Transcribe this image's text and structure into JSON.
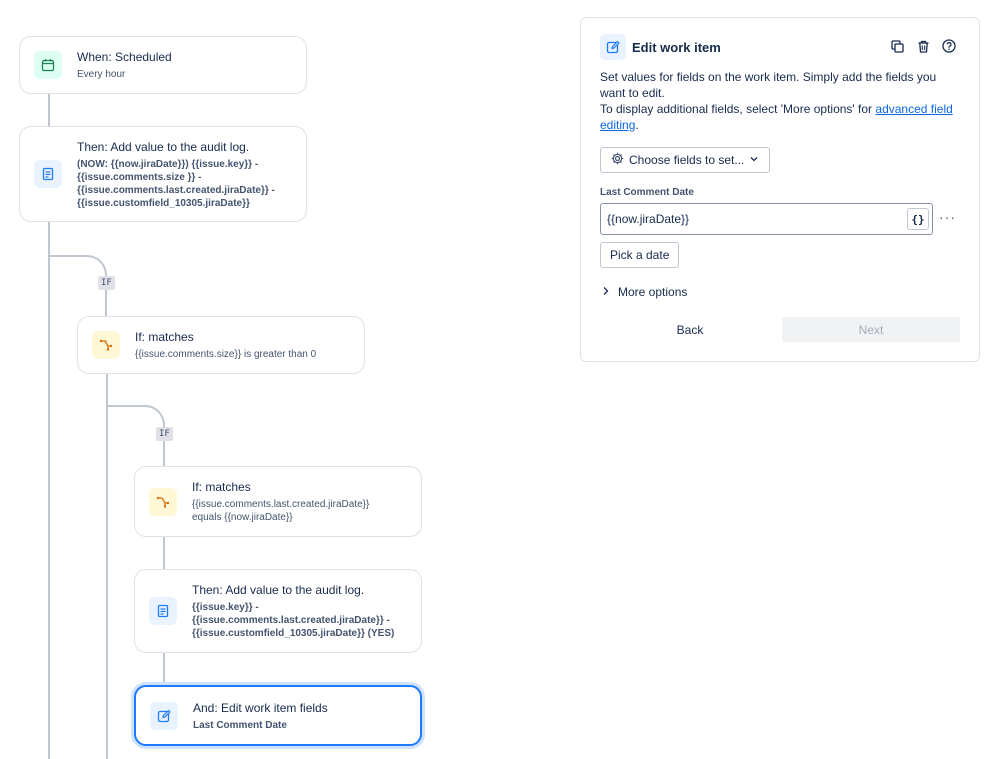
{
  "flow": {
    "trigger": {
      "title": "When: Scheduled",
      "subtitle": "Every hour"
    },
    "action1": {
      "title": "Then: Add value to the audit log.",
      "line1": "(NOW: {{now.jiraDate}}) {{issue.key}} -",
      "line2": "{{issue.comments.size }} -",
      "line3": "{{issue.comments.last.created.jiraDate}} -",
      "line4": "{{issue.customfield_10305.jiraDate}}"
    },
    "if_tag_1": "IF",
    "cond1": {
      "title": "If: matches",
      "subtitle": "{{issue.comments.size}} is greater than 0"
    },
    "if_tag_2": "IF",
    "cond2": {
      "title": "If: matches",
      "line1": "{{issue.comments.last.created.jiraDate}}",
      "line2": "equals {{now.jiraDate}}"
    },
    "action2": {
      "title": "Then: Add value to the audit log.",
      "line1": "{{issue.key}} -",
      "line2": "{{issue.comments.last.created.jiraDate}} -",
      "line3": "{{issue.customfield_10305.jiraDate}} (YES)"
    },
    "action3": {
      "title": "And: Edit work item fields",
      "subtitle": "Last Comment Date"
    }
  },
  "panel": {
    "title": "Edit work item",
    "desc_line1": "Set values for fields on the work item. Simply add the fields you want to edit.",
    "desc_line2_pre": "To display additional fields, select 'More options' for ",
    "desc_link": "advanced field editing",
    "desc_line2_post": ".",
    "choose_fields_label": "Choose fields to set...",
    "field_label": "Last Comment Date",
    "field_value": "{{now.jiraDate}}",
    "smart_value_icon": "{}",
    "more_icon": "···",
    "pick_date_label": "Pick a date",
    "more_options_label": "More options",
    "back_label": "Back",
    "next_label": "Next"
  },
  "icons": {
    "trigger": "calendar-icon",
    "audit": "document-icon",
    "condition": "branch-icon",
    "edit": "edit-icon",
    "copy": "copy-icon",
    "delete": "trash-icon",
    "help": "help-icon"
  },
  "colors": {
    "accent": "#1d7afc",
    "link": "#0c66e4",
    "condition": "#e2b203",
    "trigger": "#1f845a"
  }
}
